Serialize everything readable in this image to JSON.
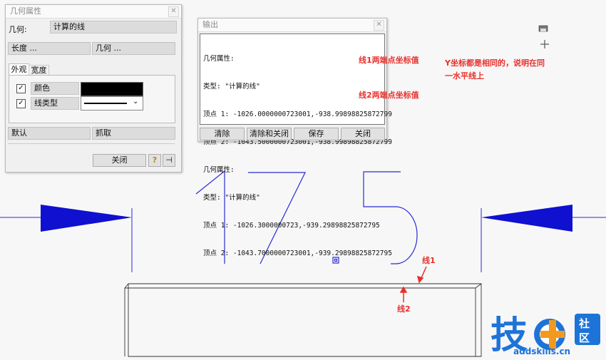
{
  "geom_panel": {
    "title": "几何属性",
    "geometry_label": "几何:",
    "geometry_value": "计算的线",
    "length_button": "长度 ...",
    "geometry_button": "几何 ...",
    "tabs": [
      "外观",
      "宽度"
    ],
    "color_label": "颜色",
    "linetype_label": "线类型",
    "color_value": "#000000",
    "default_button": "默认",
    "grab_button": "抓取",
    "close_button": "关闭",
    "help_icon": "?"
  },
  "output_panel": {
    "title": "输出",
    "lines": [
      "几何属性:",
      "类型: \"计算的线\"",
      "顶点 1: -1026.0000000723001,-938.99898825872799",
      "顶点 2: -1043.5000000723001,-938.99898825872799",
      "几何属性:",
      "类型: \"计算的线\"",
      "顶点 1: -1026.3000000723,-939.29898825872795",
      "顶点 2: -1043.7000000723001,-939.29898825872795"
    ],
    "buttons": [
      "清除",
      "清除和关闭",
      "保存",
      "关闭"
    ]
  },
  "annotations": {
    "line1_coords": "线1两端点坐标值",
    "line2_coords": "线2两端点坐标值",
    "y_note_1": "Y坐标都是相同的，说明在同",
    "y_note_2": "一水平线上",
    "line1_label": "线1",
    "line2_label": "线2"
  },
  "drawing": {
    "dimension_text": "17.5",
    "line_color": "#2b2bd6",
    "annotation_color": "#e8312d"
  },
  "watermark": {
    "logo_chars": "技 社区",
    "url": "addskills.cn",
    "brand_blue": "#1e73d8",
    "brand_orange": "#f39a1e"
  }
}
